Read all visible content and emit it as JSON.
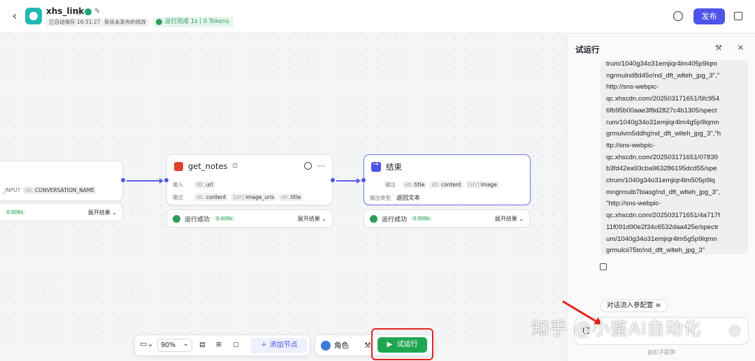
{
  "header": {
    "back_icon": "chevron-left-icon",
    "app_name": "xhs_link",
    "saved_status": "已自动保存 16:51:27",
    "unpublished_status": "有尚未发布的修改",
    "run_status": "运行完成 1s | 0 Tokens",
    "publish_label": "发布"
  },
  "canvas": {
    "start_node": {
      "fields": [
        "_INPUT",
        "CONVERSATION_NAME"
      ],
      "field_type": "str.",
      "time": "0.006s",
      "expand_label": "展开结果"
    },
    "get_notes_node": {
      "title": "get_notes",
      "input_label": "输入",
      "output_label": "输出",
      "inputs": [
        {
          "type": "str.",
          "name": "url"
        }
      ],
      "outputs": [
        {
          "type": "str.",
          "name": "content"
        },
        {
          "type": "[str]",
          "name": "image_urls"
        },
        {
          "type": "str.",
          "name": "title"
        }
      ],
      "result_label": "运行成功",
      "time": "0.408s",
      "expand_label": "展开结果"
    },
    "end_node": {
      "title": "结束",
      "output_label": "输出",
      "outputs": [
        {
          "type": "str.",
          "name": "title"
        },
        {
          "type": "str.",
          "name": "content"
        },
        {
          "type": "[str]",
          "name": "image"
        }
      ],
      "output_type_label": "输出类型",
      "output_type_value": "返回文本",
      "result_label": "运行成功",
      "time": "0.006s",
      "expand_label": "展开结果"
    }
  },
  "toolbar": {
    "zoom": "90%",
    "add_node_label": "添加节点",
    "role_label": "角色",
    "test_run_label": "试运行"
  },
  "panel": {
    "title": "试运行",
    "output_text": "trum/1040g34o31emjiqr4lm405p9lqm\nngrmulnd8d45o!nd_dft_wlteh_jpg_3\",\"\nhttp://sns-webpic-\nqc.xhscdn.com/202503171651/5fc954\n6fb95b00aae3f8d2827c4b1305/spect\nrum/1040g34o31emjiqr4lm4g5p9lqmn\ngrmulvm5ddhg!nd_dft_wlteh_jpg_3\",\"h\nttp://sns-webpic-\nqc.xhscdn.com/202503171651/07839\nb3fd42ea93cba963286195dcd55/spe\nctrum/1040g34o31emjiqr4lm505p9lq\nmngrmulb7biasg!nd_dft_wlteh_jpg_3\",\n\"http://sns-webpic-\nqc.xhscdn.com/202503171651/4a717f\n11f091d90e2f34c6532daa425e/spectr\num/1040g34o31emjiqr4lm5g5p9lqmn\ngrmulcii75to!nd_dft_wlteh_jpg_3\"",
    "config_label": "对话流入参配置",
    "footer": "由扣子提供"
  },
  "watermark": "知乎 @小鉴AI自动化",
  "colors": {
    "accent": "#4d53e8",
    "success": "#2e9d5b",
    "run_button": "#21a650",
    "annotation": "#e0251e"
  }
}
